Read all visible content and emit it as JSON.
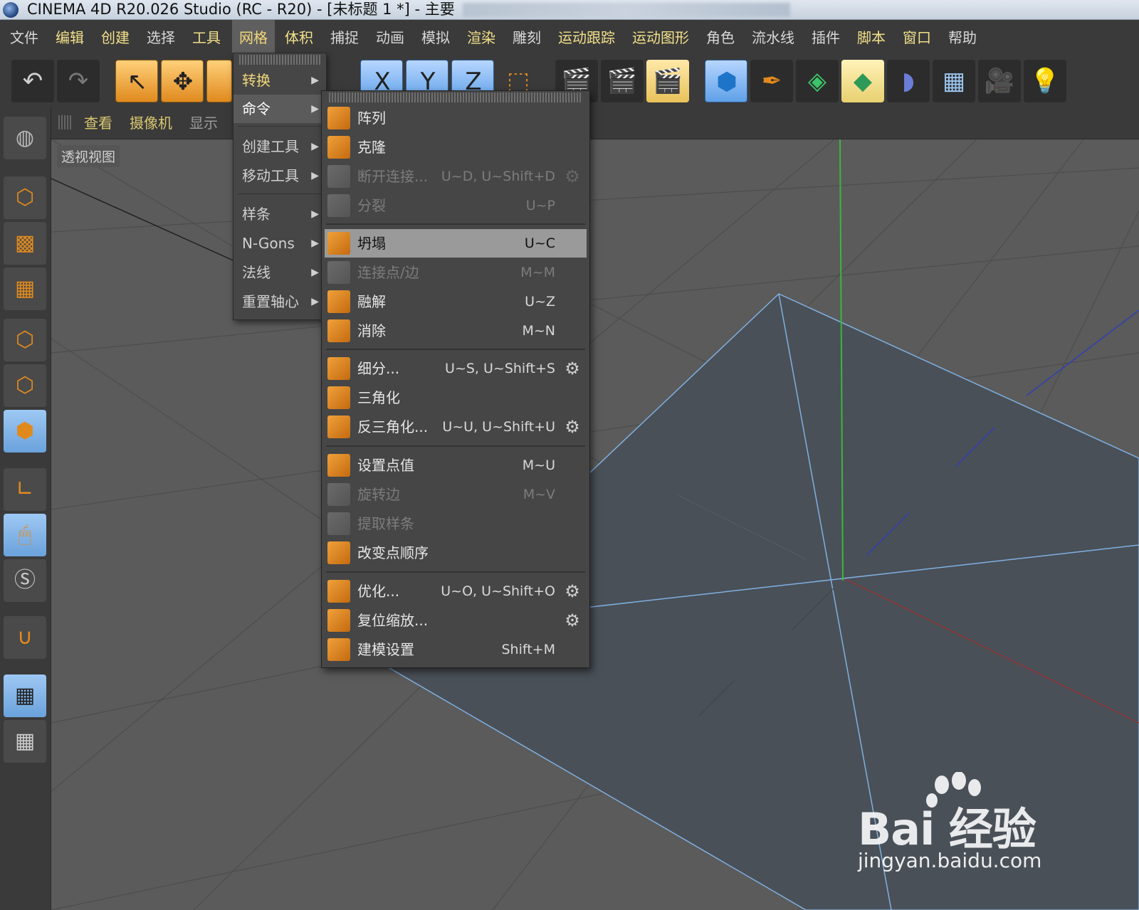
{
  "window": {
    "title": "CINEMA 4D R20.026 Studio (RC - R20) - [未标题 1 *] - 主要"
  },
  "menubar": [
    {
      "label": "文件"
    },
    {
      "label": "编辑"
    },
    {
      "label": "创建"
    },
    {
      "label": "选择"
    },
    {
      "label": "工具"
    },
    {
      "label": "网格"
    },
    {
      "label": "体积"
    },
    {
      "label": "捕捉"
    },
    {
      "label": "动画"
    },
    {
      "label": "模拟"
    },
    {
      "label": "渲染"
    },
    {
      "label": "雕刻"
    },
    {
      "label": "运动跟踪"
    },
    {
      "label": "运动图形"
    },
    {
      "label": "角色"
    },
    {
      "label": "流水线"
    },
    {
      "label": "插件"
    },
    {
      "label": "脚本"
    },
    {
      "label": "窗口"
    },
    {
      "label": "帮助"
    }
  ],
  "menubar_active": "网格",
  "toolbar": {
    "axis_x": "X",
    "axis_y": "Y",
    "axis_z": "Z"
  },
  "viewport_menu": {
    "view": "查看",
    "camera": "摄像机",
    "display": "显示"
  },
  "viewport": {
    "label": "透视视图"
  },
  "mesh_menu": [
    {
      "label": "转换"
    },
    {
      "label": "命令"
    },
    {
      "label": "创建工具"
    },
    {
      "label": "移动工具"
    },
    {
      "label": "样条"
    },
    {
      "label": "N-Gons"
    },
    {
      "label": "法线"
    },
    {
      "label": "重置轴心"
    }
  ],
  "submenu_arrow": "▶",
  "commands_menu": [
    {
      "label": "阵列",
      "shortcut": ""
    },
    {
      "label": "克隆",
      "shortcut": ""
    },
    {
      "label": "断开连接...",
      "shortcut": "U~D, U~Shift+D"
    },
    {
      "label": "分裂",
      "shortcut": "U~P"
    },
    {
      "label": "坍塌",
      "shortcut": "U~C"
    },
    {
      "label": "连接点/边",
      "shortcut": "M~M"
    },
    {
      "label": "融解",
      "shortcut": "U~Z"
    },
    {
      "label": "消除",
      "shortcut": "M~N"
    },
    {
      "label": "细分...",
      "shortcut": "U~S, U~Shift+S"
    },
    {
      "label": "三角化",
      "shortcut": ""
    },
    {
      "label": "反三角化...",
      "shortcut": "U~U, U~Shift+U"
    },
    {
      "label": "设置点值",
      "shortcut": "M~U"
    },
    {
      "label": "旋转边",
      "shortcut": "M~V"
    },
    {
      "label": "提取样条",
      "shortcut": ""
    },
    {
      "label": "改变点顺序",
      "shortcut": ""
    },
    {
      "label": "优化...",
      "shortcut": "U~O, U~Shift+O"
    },
    {
      "label": "复位缩放...",
      "shortcut": ""
    },
    {
      "label": "建模设置",
      "shortcut": "Shift+M"
    }
  ],
  "gear_glyph": "⚙",
  "watermark": {
    "brand": "Bai 经验",
    "url": "jingyan.baidu.com"
  }
}
